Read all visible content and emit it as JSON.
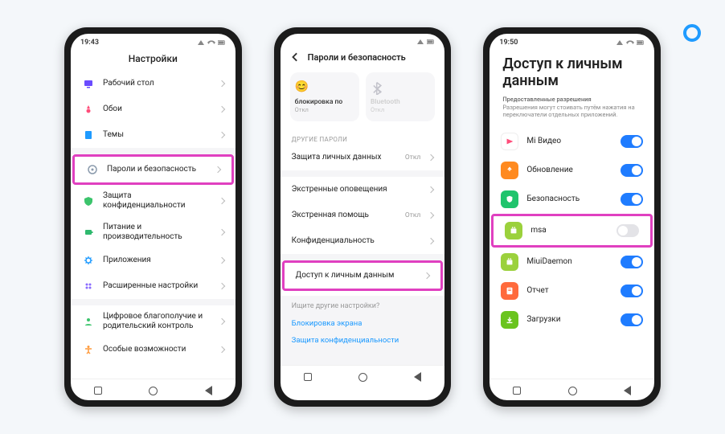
{
  "badge": {
    "color": "#1f9bff"
  },
  "phone1": {
    "time": "19:43",
    "title": "Настройки",
    "items": [
      {
        "key": "desktop",
        "label": "Рабочий стол",
        "icon_color": "#6a4bff"
      },
      {
        "key": "wallpaper",
        "label": "Обои",
        "icon_color": "#ff4d7a"
      },
      {
        "key": "themes",
        "label": "Темы",
        "icon_color": "#1f9bff"
      }
    ],
    "group2": [
      {
        "key": "passwords",
        "label": "Пароли и безопасность",
        "icon_color": "#8a9aac",
        "highlighted": true
      },
      {
        "key": "privacy",
        "label": "Защита конфиденциальности",
        "icon_color": "#3cc46c"
      },
      {
        "key": "battery",
        "label": "Питание и производительность",
        "icon_color": "#2fb96e"
      },
      {
        "key": "apps",
        "label": "Приложения",
        "icon_color": "#1f9bff"
      },
      {
        "key": "advanced",
        "label": "Расширенные настройки",
        "icon_color": "#8a6bff"
      }
    ],
    "group3": [
      {
        "key": "wellbeing",
        "label": "Цифровое благополучие и родительский контроль",
        "icon_color": "#3cc46c"
      },
      {
        "key": "accessibility",
        "label": "Особые возможности",
        "icon_color": "#ff9a3c"
      }
    ]
  },
  "phone2": {
    "time": "",
    "title": "Пароли и безопасность",
    "cards": [
      {
        "key": "face",
        "title": "блокировка по",
        "sub": "Откл",
        "icon": "😊",
        "dim": false
      },
      {
        "key": "bluetooth",
        "title": "Bluetooth",
        "sub": "Откл",
        "dim": true
      }
    ],
    "section_other": "ДРУГИЕ ПАРОЛИ",
    "rows": [
      {
        "key": "data-protect",
        "label": "Защита личных данных",
        "value": "Откл"
      }
    ],
    "rows2": [
      {
        "key": "emergency-alerts",
        "label": "Экстренные оповещения",
        "value": ""
      },
      {
        "key": "emergency-help",
        "label": "Экстренная помощь",
        "value": "Откл"
      },
      {
        "key": "confidentiality",
        "label": "Конфиденциальность",
        "value": ""
      }
    ],
    "highlight_row": {
      "key": "personal-data-access",
      "label": "Доступ к личным данным"
    },
    "search": {
      "q": "Ищите другие настройки?",
      "links": [
        "Блокировка экрана",
        "Защита конфиденциальности"
      ]
    }
  },
  "phone3": {
    "time": "19:50",
    "title": "Доступ к личным данным",
    "sub_heading": "Предоставленные разрешения",
    "sub_text": "Разрешения могут стоивать путём нажатия на переключатели отдельных приложений.",
    "apps": [
      {
        "key": "mi-video",
        "label": "Mi Видео",
        "color": "#ffffff",
        "border": "#eee",
        "on": true
      },
      {
        "key": "update",
        "label": "Обновление",
        "color": "#ff8a1f",
        "on": true
      },
      {
        "key": "security",
        "label": "Безопасность",
        "color": "#1fc46c",
        "on": true
      },
      {
        "key": "msa",
        "label": "msa",
        "color": "#9bd13c",
        "on": false,
        "highlighted": true
      },
      {
        "key": "miuidaemon",
        "label": "MiuiDaemon",
        "color": "#9bd13c",
        "on": true
      },
      {
        "key": "report",
        "label": "Отчет",
        "color": "#ff6a3c",
        "on": true
      },
      {
        "key": "downloads",
        "label": "Загрузки",
        "color": "#6ac41f",
        "on": true
      }
    ]
  }
}
